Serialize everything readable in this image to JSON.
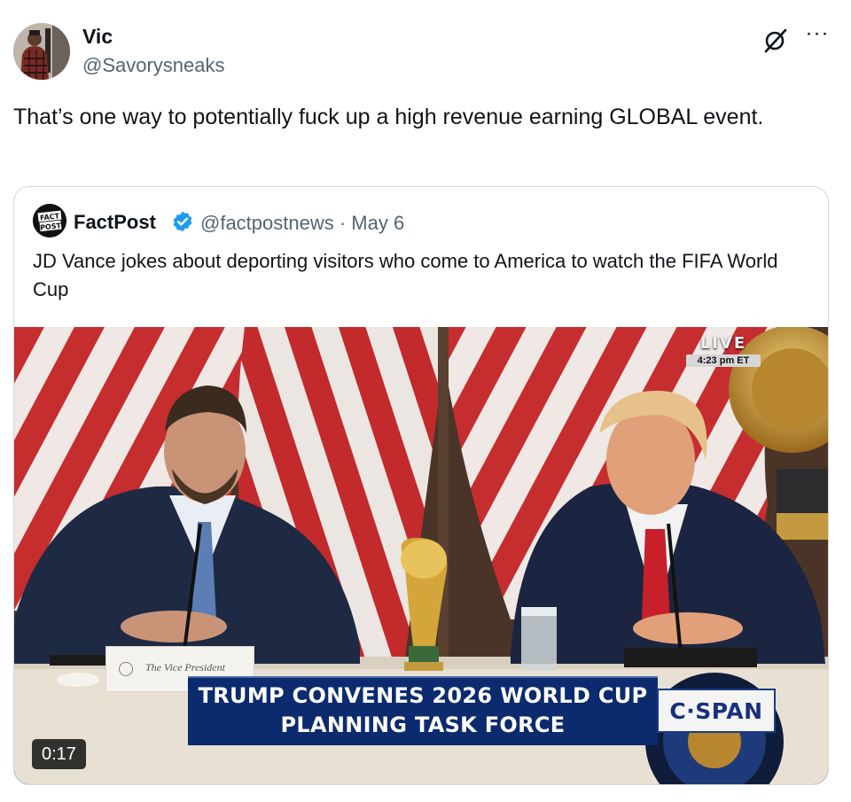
{
  "tweet": {
    "author_name": "Vic",
    "author_handle": "@Savorysneaks",
    "text": "That’s one way to potentially fuck up a high revenue earning GLOBAL event.",
    "more_label": "···"
  },
  "quoted_tweet": {
    "author_name": "FactPost",
    "author_handle_and_date": "@factpostnews · May 6",
    "avatar_text": "FACT POST",
    "text": "JD Vance jokes about deporting visitors who come to America to watch the FIFA World Cup",
    "video": {
      "live_label": "LIVE",
      "live_time": "4:23 pm ET",
      "chyron_line1": "TRUMP CONVENES 2026 WORLD CUP",
      "chyron_line2": "PLANNING TASK FORCE",
      "network_logo": "C·SPAN",
      "nameplate": "The Vice President",
      "duration": "0:17"
    }
  },
  "icons": {
    "grok": "grok-icon",
    "more": "more-icon",
    "verified": "verified-badge-icon"
  },
  "colors": {
    "text_primary": "#0f1419",
    "text_secondary": "#536471",
    "border": "#cfd9de",
    "verified_blue": "#1d9bf0",
    "chyron_blue": "#0c2b6e"
  }
}
